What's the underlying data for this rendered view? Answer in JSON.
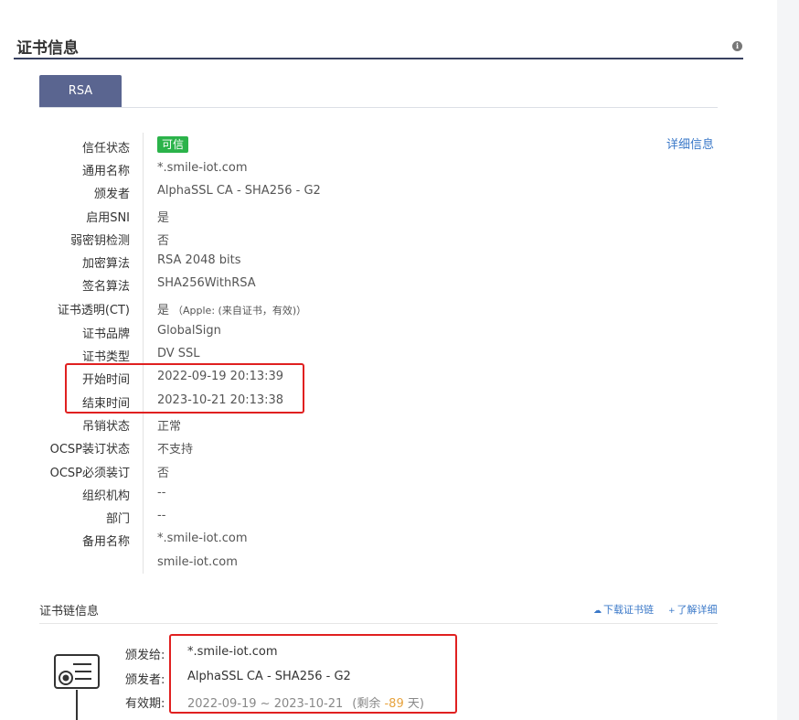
{
  "header": {
    "title": "证书信息",
    "info_icon": "i"
  },
  "tabs": [
    {
      "label": "RSA",
      "active": true
    }
  ],
  "detail_link": "详细信息",
  "trust_badge": {
    "text": "可信",
    "color": "#2bb34a"
  },
  "rows": [
    {
      "label": "信任状态",
      "value": ""
    },
    {
      "label": "通用名称",
      "value": "*.smile-iot.com"
    },
    {
      "label": "颁发者",
      "value": "AlphaSSL CA - SHA256 - G2"
    },
    {
      "label": "启用SNI",
      "value": "是"
    },
    {
      "label": "弱密钥检测",
      "value": "否"
    },
    {
      "label": "加密算法",
      "value": "RSA 2048 bits"
    },
    {
      "label": "签名算法",
      "value": "SHA256WithRSA"
    },
    {
      "label": "证书透明(CT)",
      "value": "是",
      "note": "（Apple: (来自证书，有效)）"
    },
    {
      "label": "证书品牌",
      "value": "GlobalSign"
    },
    {
      "label": "证书类型",
      "value": "DV SSL"
    },
    {
      "label": "开始时间",
      "value": "2022-09-19 20:13:39"
    },
    {
      "label": "结束时间",
      "value": "2023-10-21 20:13:38"
    },
    {
      "label": "吊销状态",
      "value": "正常"
    },
    {
      "label": "OCSP装订状态",
      "value": "不支持"
    },
    {
      "label": "OCSP必须装订",
      "value": "否"
    },
    {
      "label": "组织机构",
      "value": "--"
    },
    {
      "label": "部门",
      "value": "--"
    },
    {
      "label": "备用名称",
      "value": "*.smile-iot.com"
    },
    {
      "label": "",
      "value": "smile-iot.com"
    }
  ],
  "chain": {
    "title": "证书链信息",
    "download_label": "下载证书链",
    "learn_more_label": "了解详细",
    "issued_to_label": "颁发给:",
    "issued_to": "*.smile-iot.com",
    "issuer_label": "颁发者:",
    "issuer": "AlphaSSL CA - SHA256 - G2",
    "validity_label": "有效期:",
    "validity": "2022-09-19 ~ 2023-10-21",
    "remaining_prefix": "(剩余",
    "remaining_days": "-89",
    "remaining_suffix": "天)"
  },
  "colors": {
    "accent": "#5a6590",
    "header_rule": "#384160",
    "link": "#3a78c8",
    "highlight_box": "#e02020",
    "remaining_days": "#e7a33e"
  }
}
